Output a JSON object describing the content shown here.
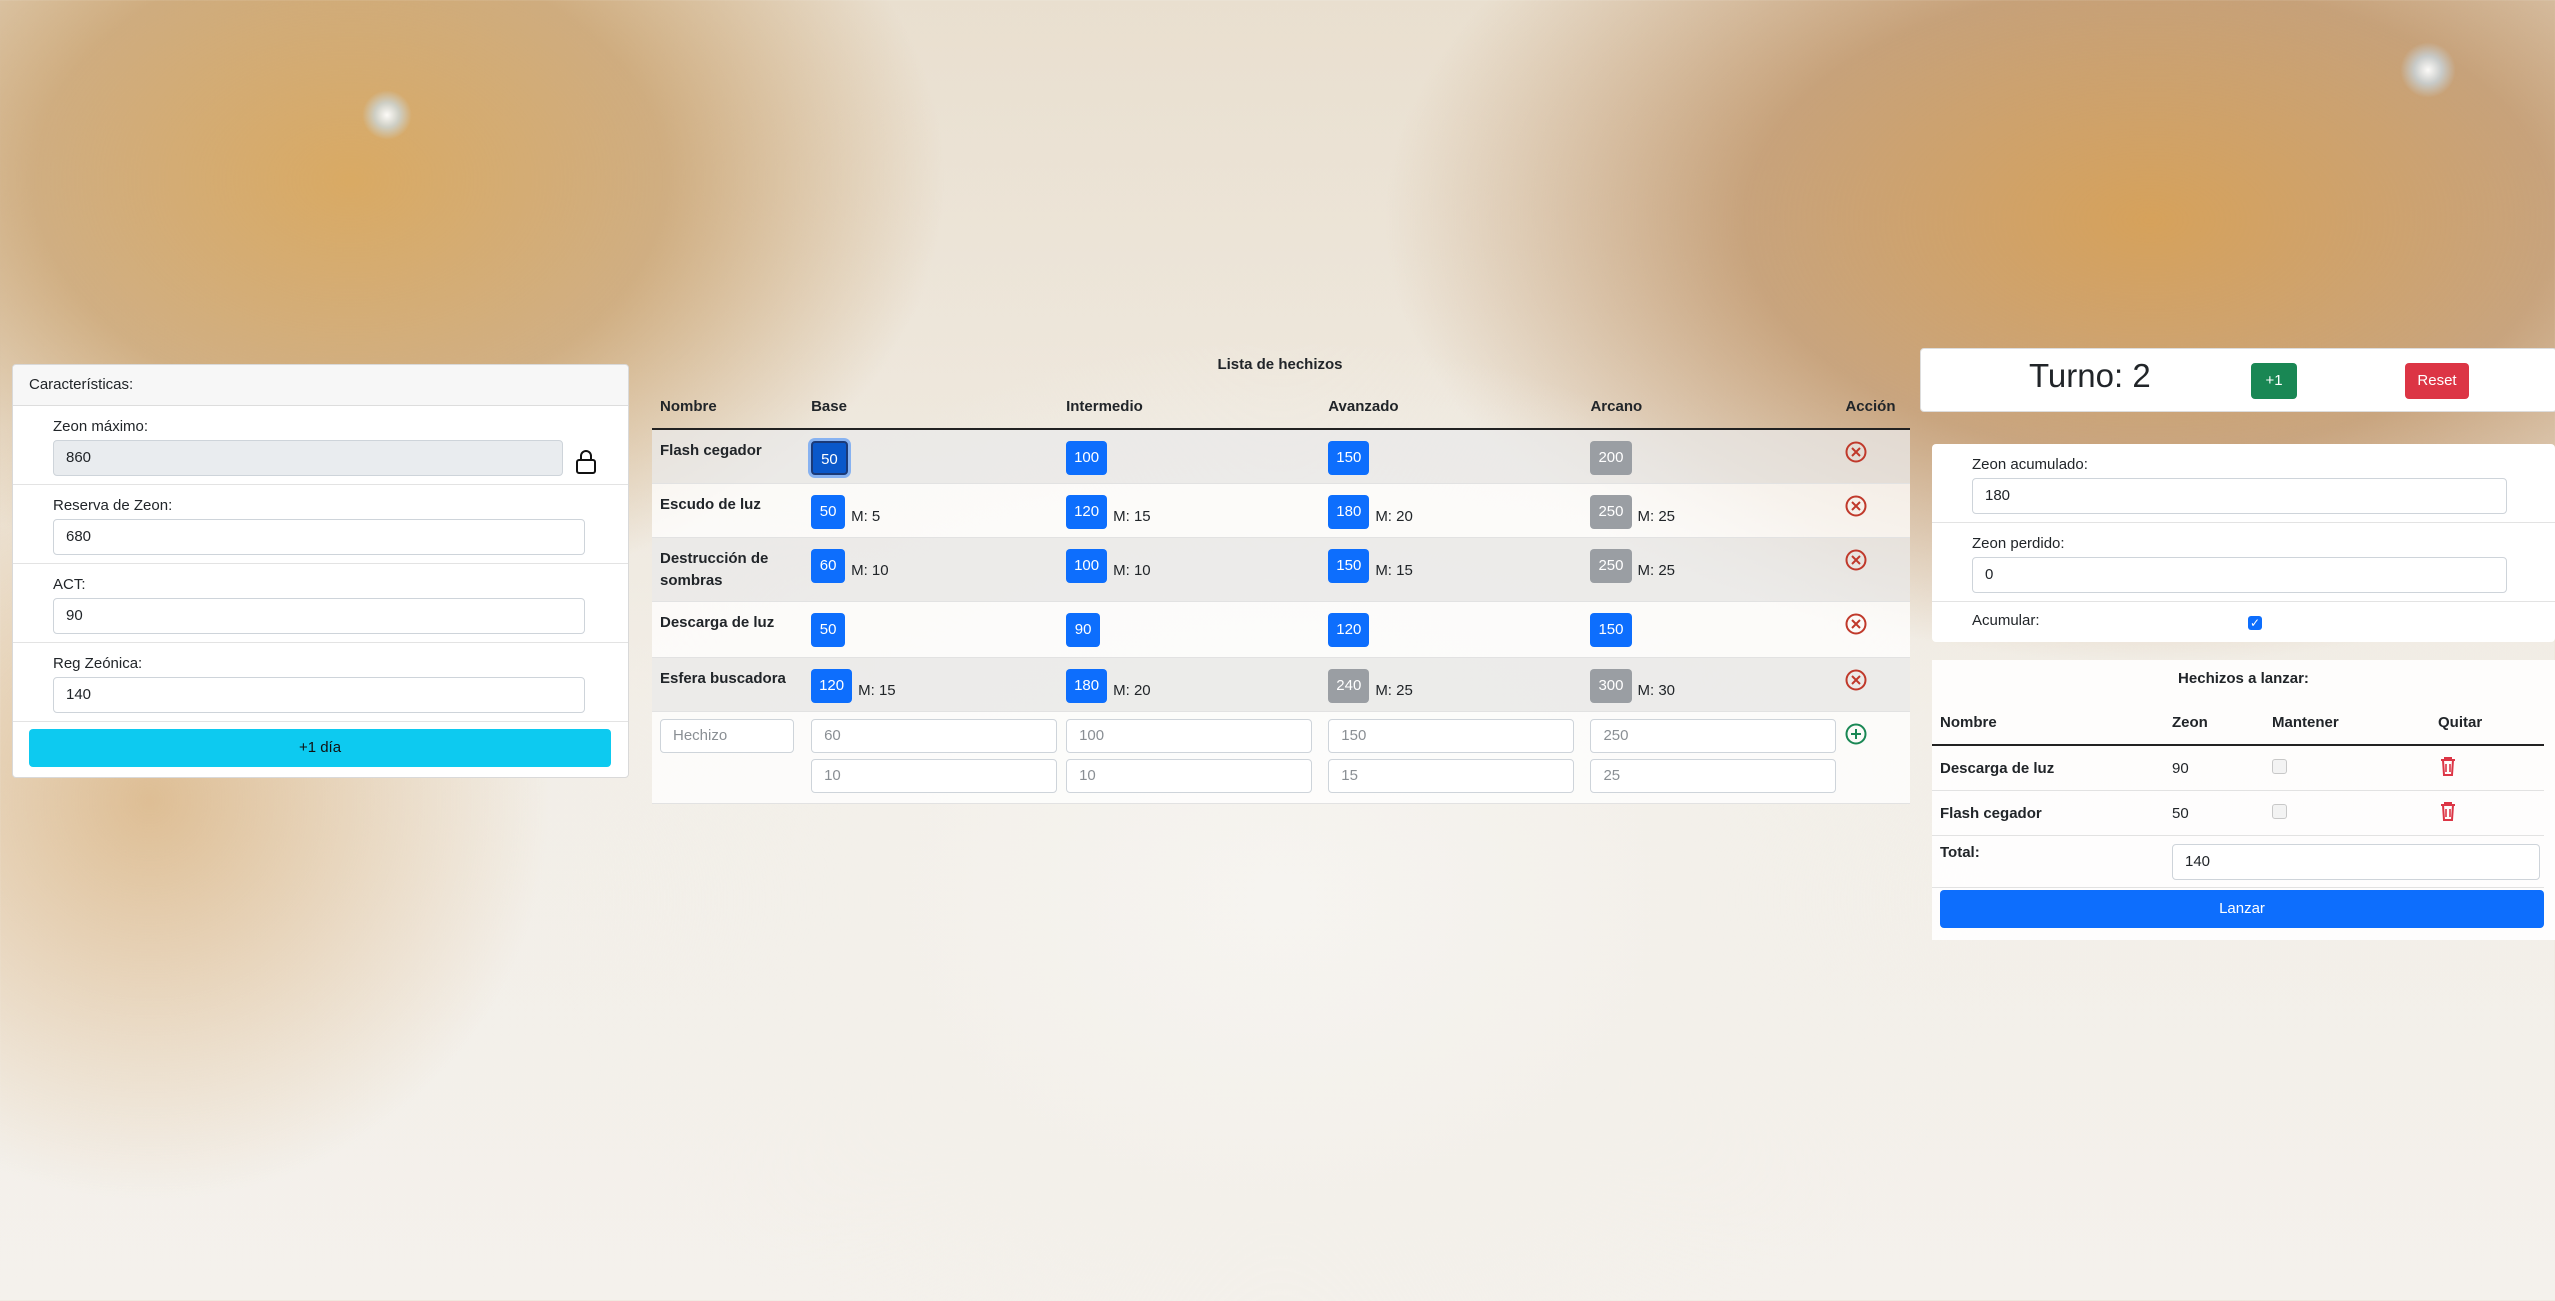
{
  "characteristics": {
    "header": "Características:",
    "zeon_max_label": "Zeon máximo:",
    "zeon_max_value": "860",
    "reserve_label": "Reserva de Zeon:",
    "reserve_value": "680",
    "act_label": "ACT:",
    "act_value": "90",
    "reg_label": "Reg Zeónica:",
    "reg_value": "140",
    "plus_day_label": "+1 día"
  },
  "spell_list": {
    "title": "Lista de hechizos",
    "columns": [
      "Nombre",
      "Base",
      "Intermedio",
      "Avanzado",
      "Arcano",
      "Acción"
    ],
    "rows": [
      {
        "name": "Flash cegador",
        "levels": [
          {
            "v": "50",
            "m": ""
          },
          {
            "v": "100",
            "m": ""
          },
          {
            "v": "150",
            "m": ""
          },
          {
            "v": "200",
            "m": ""
          }
        ]
      },
      {
        "name": "Escudo de luz",
        "levels": [
          {
            "v": "50",
            "m": "M: 5"
          },
          {
            "v": "120",
            "m": "M: 15"
          },
          {
            "v": "180",
            "m": "M: 20"
          },
          {
            "v": "250",
            "m": "M: 25"
          }
        ]
      },
      {
        "name": "Destrucción de sombras",
        "levels": [
          {
            "v": "60",
            "m": "M: 10"
          },
          {
            "v": "100",
            "m": "M: 10"
          },
          {
            "v": "150",
            "m": "M: 15"
          },
          {
            "v": "250",
            "m": "M: 25"
          }
        ]
      },
      {
        "name": "Descarga de luz",
        "levels": [
          {
            "v": "50",
            "m": ""
          },
          {
            "v": "90",
            "m": ""
          },
          {
            "v": "120",
            "m": ""
          },
          {
            "v": "150",
            "m": ""
          }
        ]
      },
      {
        "name": "Esfera buscadora",
        "levels": [
          {
            "v": "120",
            "m": "M: 15"
          },
          {
            "v": "180",
            "m": "M: 20"
          },
          {
            "v": "240",
            "m": "M: 25"
          },
          {
            "v": "300",
            "m": "M: 30"
          }
        ]
      }
    ],
    "new_spell": {
      "name_placeholder": "Hechizo",
      "base": "60",
      "base_m": "10",
      "intermediate": "100",
      "intermediate_m": "10",
      "advanced": "150",
      "advanced_m": "15",
      "arcane": "250",
      "arcane_m": "25"
    }
  },
  "turn": {
    "title": "Turno: 2",
    "plus_label": "+1",
    "reset_label": "Reset"
  },
  "zeon": {
    "accumulated_label": "Zeon acumulado:",
    "accumulated_value": "180",
    "lost_label": "Zeon perdido:",
    "lost_value": "0",
    "accumulate_label": "Acumular:"
  },
  "cast": {
    "title": "Hechizos a lanzar:",
    "columns": [
      "Nombre",
      "Zeon",
      "Mantener",
      "Quitar"
    ],
    "rows": [
      {
        "name": "Descarga de luz",
        "zeon": "90"
      },
      {
        "name": "Flash cegador",
        "zeon": "50"
      }
    ],
    "total_label": "Total:",
    "total_value": "140",
    "launch_label": "Lanzar"
  },
  "colors": {
    "primary": "#0d6efd",
    "info": "#0dcaf0",
    "success": "#198754",
    "danger": "#dc3545",
    "secondary": "#9a9ea3"
  }
}
